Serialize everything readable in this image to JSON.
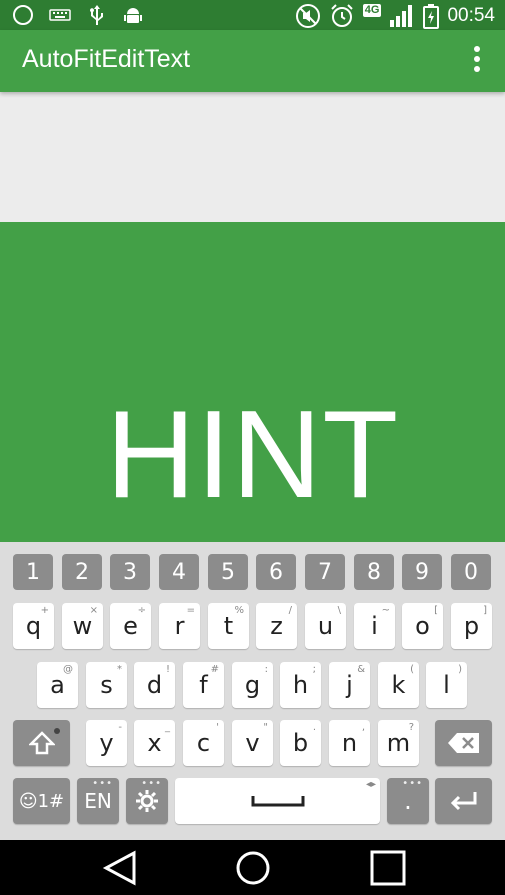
{
  "status_bar": {
    "time": "00:54",
    "network": "4G",
    "left_icons": [
      "circle-icon",
      "keyboard-icon",
      "usb-icon",
      "android-debug-icon"
    ],
    "right_icons": [
      "mute-icon",
      "alarm-icon",
      "signal-icon",
      "battery-icon"
    ]
  },
  "app_bar": {
    "title": "AutoFitEditText",
    "menu_icon": "overflow-menu-icon"
  },
  "edit_text": {
    "hint": "HINT"
  },
  "keyboard": {
    "numbers": [
      "1",
      "2",
      "3",
      "4",
      "5",
      "6",
      "7",
      "8",
      "9",
      "0"
    ],
    "row1": [
      {
        "key": "q",
        "sub": "+"
      },
      {
        "key": "w",
        "sub": "×"
      },
      {
        "key": "e",
        "sub": "÷"
      },
      {
        "key": "r",
        "sub": "="
      },
      {
        "key": "t",
        "sub": "%"
      },
      {
        "key": "z",
        "sub": "/"
      },
      {
        "key": "u",
        "sub": "\\"
      },
      {
        "key": "i",
        "sub": "~"
      },
      {
        "key": "o",
        "sub": "["
      },
      {
        "key": "p",
        "sub": "]"
      }
    ],
    "row2": [
      {
        "key": "a",
        "sub": "@"
      },
      {
        "key": "s",
        "sub": "*"
      },
      {
        "key": "d",
        "sub": "!"
      },
      {
        "key": "f",
        "sub": "#"
      },
      {
        "key": "g",
        "sub": ":"
      },
      {
        "key": "h",
        "sub": ";"
      },
      {
        "key": "j",
        "sub": "&"
      },
      {
        "key": "k",
        "sub": "("
      },
      {
        "key": "l",
        "sub": ")"
      }
    ],
    "row3": [
      {
        "key": "y",
        "sub": "-"
      },
      {
        "key": "x",
        "sub": "_"
      },
      {
        "key": "c",
        "sub": "'"
      },
      {
        "key": "v",
        "sub": "\""
      },
      {
        "key": "b",
        "sub": "."
      },
      {
        "key": "n",
        "sub": ","
      },
      {
        "key": "m",
        "sub": "?"
      }
    ],
    "symbols_label": "☺1#",
    "language_label": "EN",
    "period_label": "."
  },
  "nav_bar": {
    "back_icon": "back-triangle-icon",
    "home_icon": "home-circle-icon",
    "recents_icon": "recents-square-icon"
  }
}
